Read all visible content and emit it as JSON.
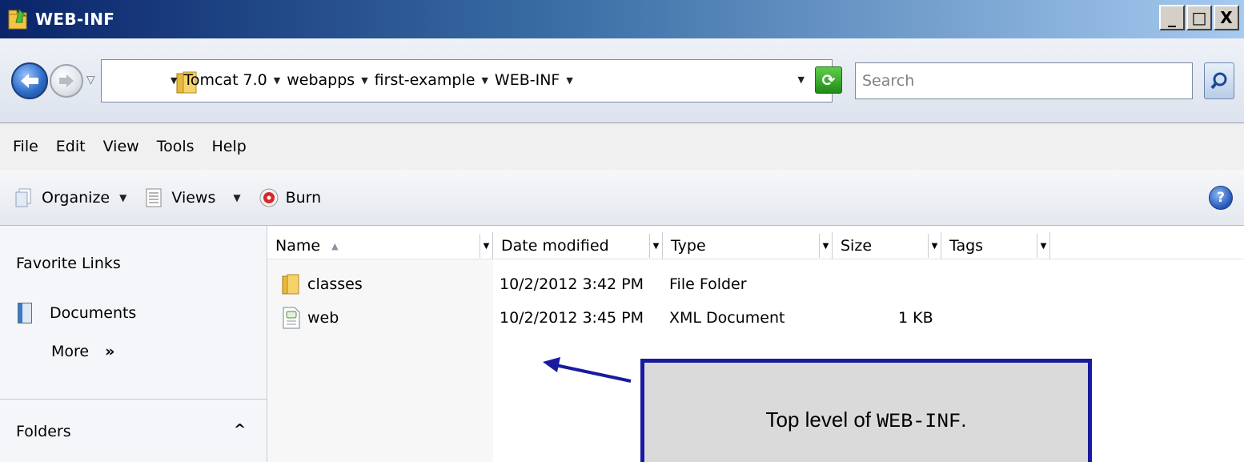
{
  "window": {
    "title": "WEB-INF",
    "controls": {
      "minimize": "_",
      "maximize": "□",
      "close": "X"
    }
  },
  "address": {
    "breadcrumbs": [
      "Tomcat 7.0",
      "webapps",
      "first-example",
      "WEB-INF"
    ],
    "search_placeholder": "Search"
  },
  "menu": [
    "File",
    "Edit",
    "View",
    "Tools",
    "Help"
  ],
  "toolbar": {
    "organize": "Organize",
    "views": "Views",
    "burn": "Burn",
    "help_icon": "?"
  },
  "navpane": {
    "favorite_links": "Favorite Links",
    "documents": "Documents",
    "more": "More",
    "more_chevron": "»",
    "folders": "Folders",
    "folders_caret": "^"
  },
  "columns": [
    "Name",
    "Date modified",
    "Type",
    "Size",
    "Tags"
  ],
  "files": [
    {
      "name": "classes",
      "date": "10/2/2012 3:42 PM",
      "type": "File Folder",
      "size": "",
      "icon": "folder-icon"
    },
    {
      "name": "web",
      "date": "10/2/2012 3:45 PM",
      "type": "XML Document",
      "size": "1 KB",
      "icon": "xml-file-icon"
    }
  ],
  "callout": {
    "text_before": "Top level of ",
    "code": "WEB-INF",
    "text_after": ".",
    "border_color": "#1a1aa0"
  }
}
